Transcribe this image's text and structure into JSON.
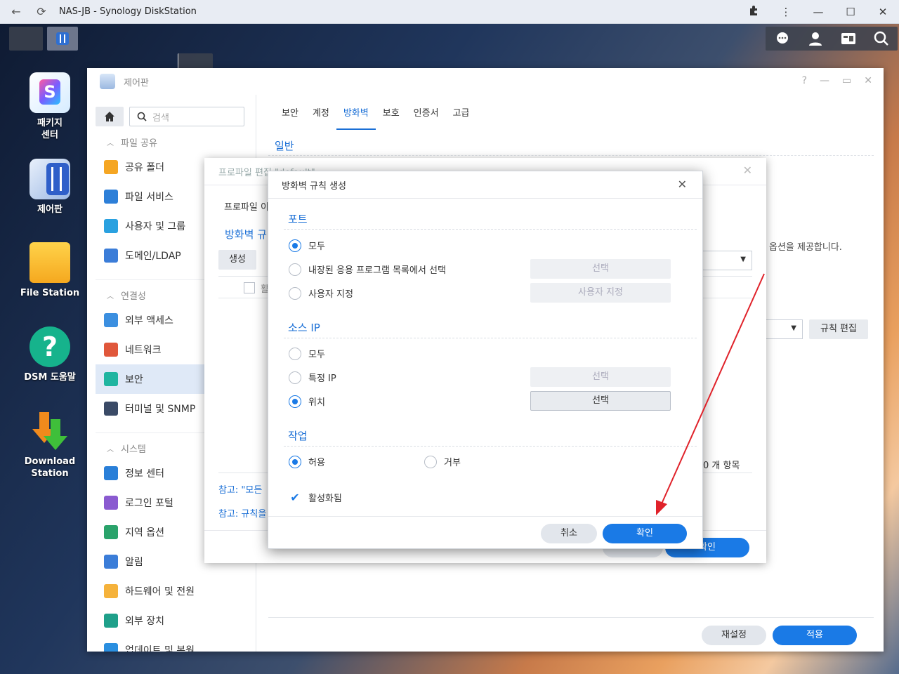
{
  "browser": {
    "title": "NAS-JB - Synology DiskStation",
    "back_icon": "←",
    "reload_icon": "⟳"
  },
  "desktop": {
    "icons": [
      {
        "label": "패키지\n센터"
      },
      {
        "label": "제어판"
      },
      {
        "label": "File Station"
      },
      {
        "label": "DSM 도움말"
      },
      {
        "label": "Download Station"
      }
    ]
  },
  "control_panel": {
    "title": "제어판",
    "search_placeholder": "검색",
    "sidebar": {
      "sections": [
        {
          "label": "파일 공유"
        },
        {
          "label": "연결성"
        },
        {
          "label": "시스템"
        }
      ],
      "items": [
        {
          "label": "공유 폴더",
          "color": "#f5a623"
        },
        {
          "label": "파일 서비스",
          "color": "#2d7fd8"
        },
        {
          "label": "사용자 및 그룹",
          "color": "#2aa1e0"
        },
        {
          "label": "도메인/LDAP",
          "color": "#3b7dd8"
        },
        {
          "label": "외부 액세스",
          "color": "#3b8fe0"
        },
        {
          "label": "네트워크",
          "color": "#e0573b"
        },
        {
          "label": "보안",
          "color": "#1fb5a0"
        },
        {
          "label": "터미널 및 SNMP",
          "color": "#3a4a66"
        },
        {
          "label": "정보 센터",
          "color": "#2a7fd8"
        },
        {
          "label": "로그인 포털",
          "color": "#8a5ad0"
        },
        {
          "label": "지역 옵션",
          "color": "#2aa36b"
        },
        {
          "label": "알림",
          "color": "#3b7dd8"
        },
        {
          "label": "하드웨어 및 전원",
          "color": "#f5b23b"
        },
        {
          "label": "외부 장치",
          "color": "#1fa08a"
        },
        {
          "label": "업데이트 및 복원",
          "color": "#2a8fe0"
        }
      ]
    },
    "tabs": [
      "보안",
      "계정",
      "방화벽",
      "보호",
      "인증서",
      "고급"
    ],
    "active_tab": "방화벽",
    "section_general": "일반",
    "desc_partial": "옵션을 제공합니다.",
    "rule_edit_button": "규칙 편집",
    "reset_button": "재설정",
    "apply_button": "적용"
  },
  "profile_edit": {
    "title": "프로파일 편집 \"default\"",
    "label_profile": "프로파일 이",
    "label_firewall": "방화벽 규",
    "create_button": "생성",
    "header_partial": "활",
    "count_text": "0 개 항목",
    "note1": "참고: \"모든",
    "note2": "참고: 규칙을",
    "ok_button": "확인"
  },
  "firewall_dialog": {
    "title": "방화벽 규칙 생성",
    "close_icon": "✕",
    "port": {
      "section": "포트",
      "options": [
        "모두",
        "내장된 응용 프로그램 목록에서 선택",
        "사용자 지정"
      ],
      "selected": 0,
      "select_button": "선택",
      "custom_button": "사용자 지정"
    },
    "source_ip": {
      "section": "소스 IP",
      "options": [
        "모두",
        "특정 IP",
        "위치"
      ],
      "selected": 2,
      "specific_select_button": "선택",
      "location_select_button": "선택"
    },
    "action": {
      "section": "작업",
      "allow": "허용",
      "deny": "거부",
      "selected": "허용"
    },
    "enabled_label": "활성화됨",
    "enabled": true,
    "cancel_button": "취소",
    "ok_button": "확인"
  },
  "colors": {
    "accent": "#1a7ae6",
    "annotation_arrow": "#e0222a"
  }
}
